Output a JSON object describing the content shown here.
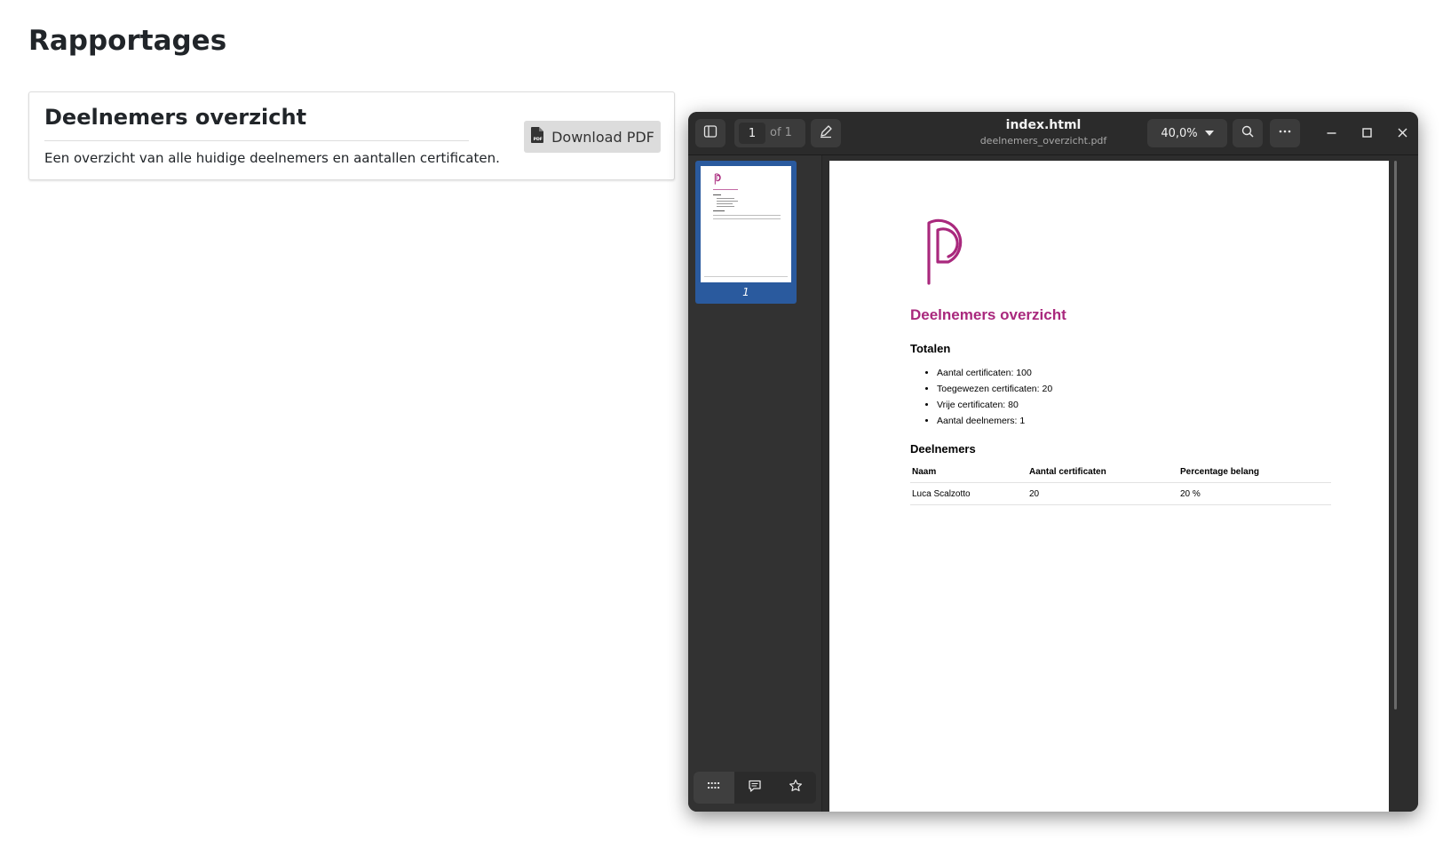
{
  "page": {
    "title": "Rapportages"
  },
  "card": {
    "title": "Deelnemers overzicht",
    "description": "Een overzicht van alle huidige deelnemers en aantallen certificaten.",
    "download_label": "Download PDF"
  },
  "viewer": {
    "title": "index.html",
    "filename": "deelnemers_overzicht.pdf",
    "page_current": "1",
    "page_of": "of 1",
    "zoom": "40,0%",
    "thumbnail_label": "1"
  },
  "pdf": {
    "title": "Deelnemers overzicht",
    "totals_heading": "Totalen",
    "totals": [
      "Aantal certificaten: 100",
      "Toegewezen certificaten: 20",
      "Vrije certificaten: 80",
      "Aantal deelnemers: 1"
    ],
    "participants_heading": "Deelnemers",
    "table": {
      "headers": [
        "Naam",
        "Aantal certificaten",
        "Percentage belang"
      ],
      "rows": [
        [
          "Luca Scalzotto",
          "20",
          "20 %"
        ]
      ]
    }
  },
  "colors": {
    "brand": "#a9287d",
    "thumbnail_selected": "#2a5a9e"
  }
}
